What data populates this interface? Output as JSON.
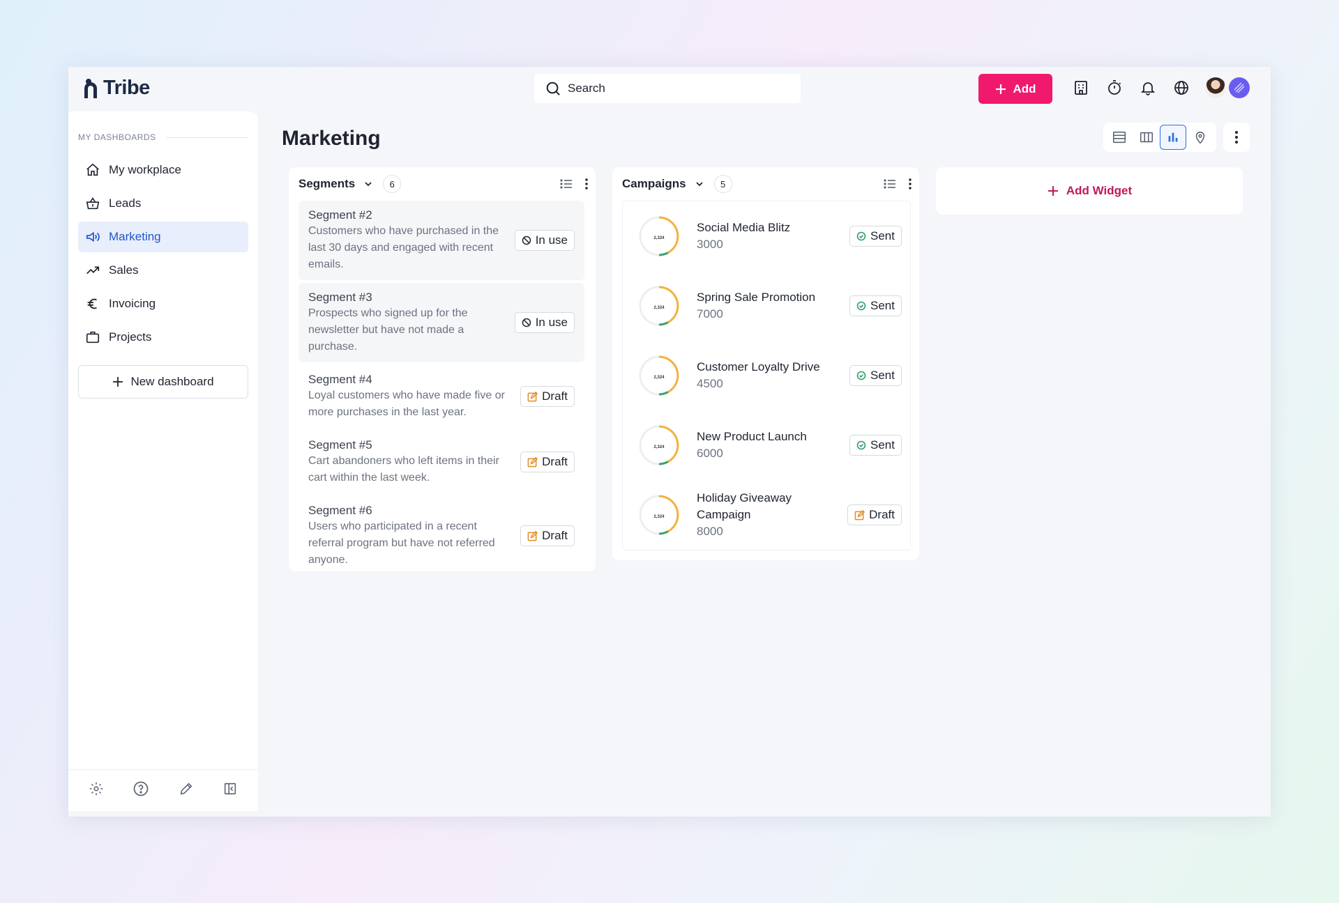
{
  "app": {
    "name": "Tribe"
  },
  "search": {
    "placeholder": "Search"
  },
  "header": {
    "add_label": "Add",
    "icons": [
      "building-icon",
      "timer-icon",
      "bell-icon",
      "globe-icon"
    ]
  },
  "sidebar": {
    "heading": "MY DASHBOARDS",
    "items": [
      {
        "label": "My workplace",
        "icon": "home-icon",
        "active": false
      },
      {
        "label": "Leads",
        "icon": "basket-icon",
        "active": false
      },
      {
        "label": "Marketing",
        "icon": "megaphone-icon",
        "active": true
      },
      {
        "label": "Sales",
        "icon": "trending-up-icon",
        "active": false
      },
      {
        "label": "Invoicing",
        "icon": "euro-icon",
        "active": false
      },
      {
        "label": "Projects",
        "icon": "briefcase-icon",
        "active": false
      }
    ],
    "new_dashboard_label": "New dashboard",
    "footer_icons": [
      "gear-icon",
      "help-icon",
      "pencil-icon",
      "collapse-sidebar-icon"
    ]
  },
  "page": {
    "title": "Marketing",
    "active_view": "chart"
  },
  "segments": {
    "title": "Segments",
    "count": "6",
    "items": [
      {
        "name": "Segment #2",
        "desc": "Customers who have purchased in the last 30 days and engaged with recent emails.",
        "status": "In use"
      },
      {
        "name": "Segment #3",
        "desc": "Prospects who signed up for the newsletter but have not made a purchase.",
        "status": "In use"
      },
      {
        "name": "Segment #4",
        "desc": "Loyal customers who have made five or more purchases in the last year.",
        "status": "Draft"
      },
      {
        "name": "Segment #5",
        "desc": "Cart abandoners who left items in their cart within the last week.",
        "status": "Draft"
      },
      {
        "name": "Segment #6",
        "desc": "Users who participated in a recent referral program but have not referred anyone.",
        "status": "Draft"
      }
    ]
  },
  "campaigns": {
    "title": "Campaigns",
    "count": "5",
    "ring_label": "2,324",
    "items": [
      {
        "name": "Social Media Blitz",
        "value": "3000",
        "status": "Sent"
      },
      {
        "name": "Spring Sale Promotion",
        "value": "7000",
        "status": "Sent"
      },
      {
        "name": "Customer Loyalty Drive",
        "value": "4500",
        "status": "Sent"
      },
      {
        "name": "New Product Launch",
        "value": "6000",
        "status": "Sent"
      },
      {
        "name": "Holiday Giveaway Campaign",
        "value": "8000",
        "status": "Draft"
      }
    ]
  },
  "add_widget_label": "Add Widget",
  "colors": {
    "accent": "#f0196e",
    "active_nav": "#2157c9",
    "add_widget": "#c2185b",
    "sent": "#2e9e6a",
    "draft": "#e58a1f"
  }
}
